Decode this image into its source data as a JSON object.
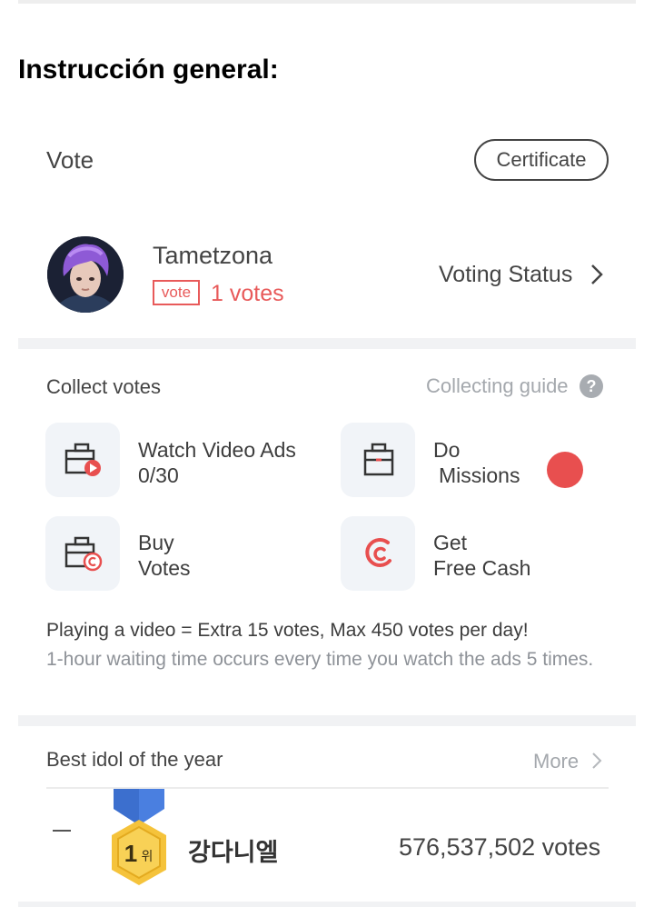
{
  "instruction": "Instrucción general:",
  "vote_section": {
    "title": "Vote",
    "certificate_label": "Certificate"
  },
  "user": {
    "name": "Tametzona",
    "tag": "vote",
    "votes": "1 votes",
    "voting_status": "Voting Status"
  },
  "collect": {
    "title": "Collect votes",
    "guide": "Collecting guide",
    "help_icon": "?",
    "tiles": [
      {
        "icon": "video-ad-icon",
        "line1": "Watch Video Ads",
        "line2": "0/30"
      },
      {
        "icon": "mission-icon",
        "line1": "Do",
        "line2": "Missions"
      },
      {
        "icon": "buy-votes-icon",
        "line1": "Buy",
        "line2": "Votes"
      },
      {
        "icon": "free-cash-icon",
        "line1": "Get",
        "line2": "Free Cash"
      }
    ],
    "note_main": "Playing a video = Extra 15 votes, Max 450 votes per day!",
    "note_sub": "1-hour waiting time occurs every time you watch the ads 5 times."
  },
  "best_idol": {
    "title": "Best idol of the year",
    "more": "More",
    "rank_change": "—",
    "rank_number": "1",
    "rank_suffix": "위",
    "name": "강다니엘",
    "votes": "576,537,502 votes"
  },
  "colors": {
    "accent_red": "#e85a5a",
    "mission_dot": "#e84f4f",
    "medal_ribbon": "#4a7fe0",
    "medal_gold": "#f5c33b",
    "tile_bg": "#f1f4f8",
    "divider": "#f1f2f4"
  }
}
